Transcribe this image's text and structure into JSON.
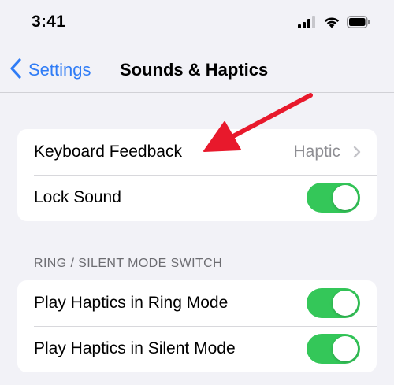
{
  "status_bar": {
    "time": "3:41"
  },
  "nav": {
    "back_label": "Settings",
    "title": "Sounds & Haptics"
  },
  "groups": [
    {
      "rows": [
        {
          "label": "Keyboard Feedback",
          "value": "Haptic"
        },
        {
          "label": "Lock Sound",
          "toggle_on": true
        }
      ]
    },
    {
      "header": "RING / SILENT MODE SWITCH",
      "rows": [
        {
          "label": "Play Haptics in Ring Mode",
          "toggle_on": true
        },
        {
          "label": "Play Haptics in Silent Mode",
          "toggle_on": true
        }
      ]
    }
  ],
  "icons": {
    "back": "chevron-left-icon",
    "disclosure": "chevron-right-icon",
    "signal": "cellular-signal-icon",
    "wifi": "wifi-icon",
    "battery": "battery-icon",
    "annotation": "red-arrow-icon"
  },
  "colors": {
    "accent": "#2f7cf6",
    "toggle_on": "#34c759",
    "background": "#f2f2f7",
    "annotation": "#e8192c"
  }
}
